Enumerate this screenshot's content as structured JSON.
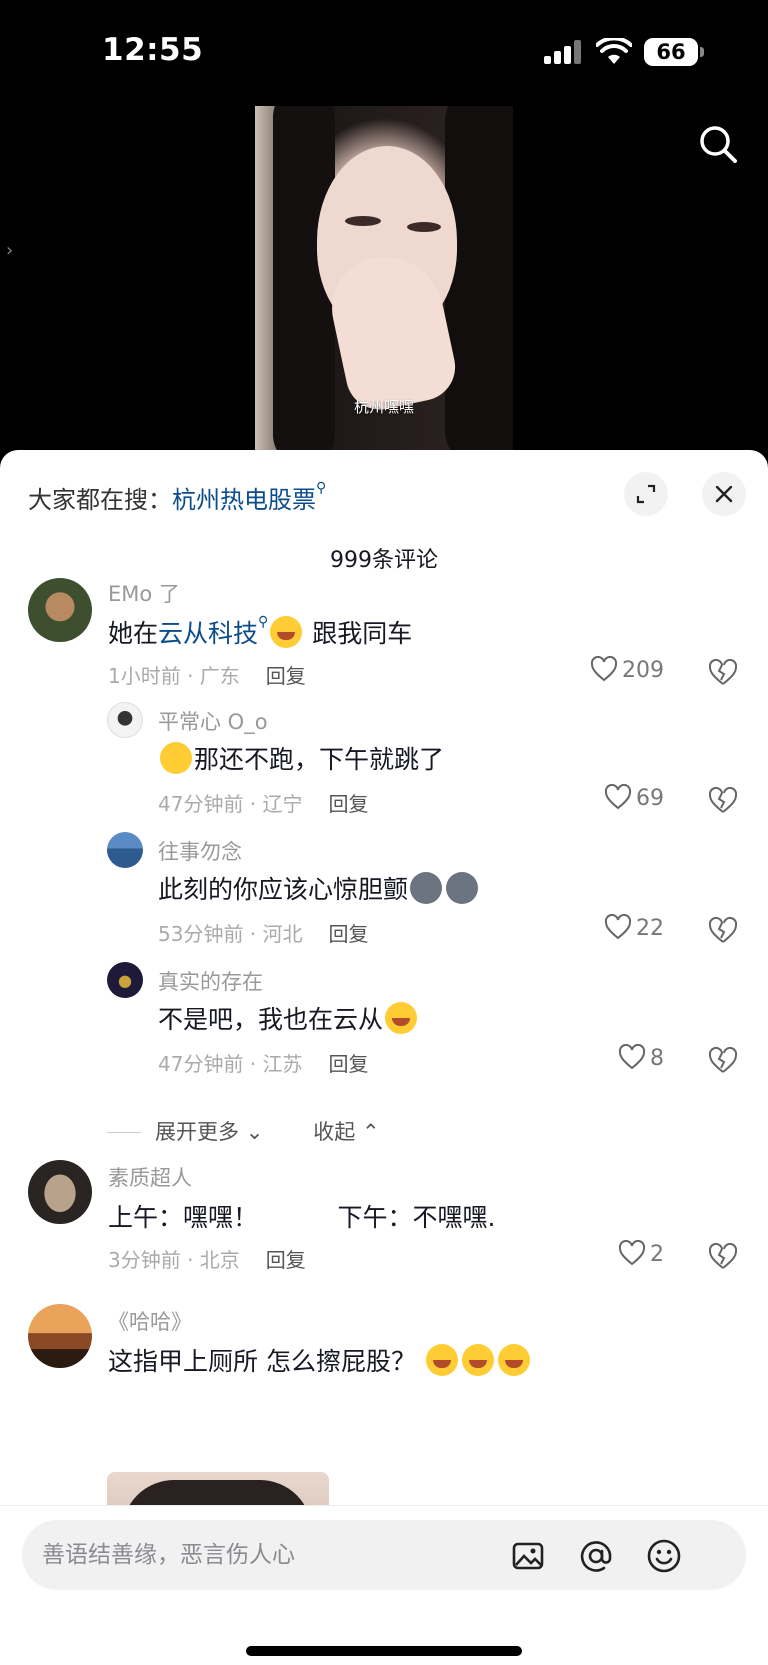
{
  "status_bar": {
    "time": "12:55",
    "battery": "66"
  },
  "video": {
    "caption": "杭州嘿嘿"
  },
  "sheet": {
    "hot_search_prefix": "大家都在搜：",
    "hot_search_keyword": "杭州热电股票",
    "comment_count": "999条评论"
  },
  "comments": [
    {
      "author": "EMo 了",
      "text_pre": "她在",
      "link": "云从科技",
      "text_post": " 跟我同车",
      "meta": "1小时前 · 广东",
      "reply": "回复",
      "likes": "209"
    },
    {
      "author": "平常心 O_o",
      "text": "那还不跑，下午就跳了",
      "meta": "47分钟前 · 辽宁",
      "reply": "回复",
      "likes": "69"
    },
    {
      "author": "往事勿念",
      "text": "此刻的你应该心惊胆颤",
      "meta": "53分钟前 · 河北",
      "reply": "回复",
      "likes": "22"
    },
    {
      "author": "真实的存在",
      "text": "不是吧，我也在云从",
      "meta": "47分钟前 · 江苏",
      "reply": "回复",
      "likes": "8"
    },
    {
      "author": "素质超人",
      "text": "上午：嘿嘿！          下午：不嘿嘿.",
      "meta": "3分钟前 · 北京",
      "reply": "回复",
      "likes": "2"
    },
    {
      "author": "《哈哈》",
      "text": "这指甲上厕所 怎么擦屁股？"
    }
  ],
  "expand": {
    "more": "展开更多",
    "collapse": "收起"
  },
  "input": {
    "placeholder": "善语结善缘，恶言伤人心"
  },
  "icons": {
    "search": "search-icon",
    "expand": "expand-icon",
    "close": "close-icon",
    "like": "heart-icon",
    "dislike": "broken-heart-icon",
    "image": "image-icon",
    "mention": "at-icon",
    "emoji": "emoji-icon"
  }
}
